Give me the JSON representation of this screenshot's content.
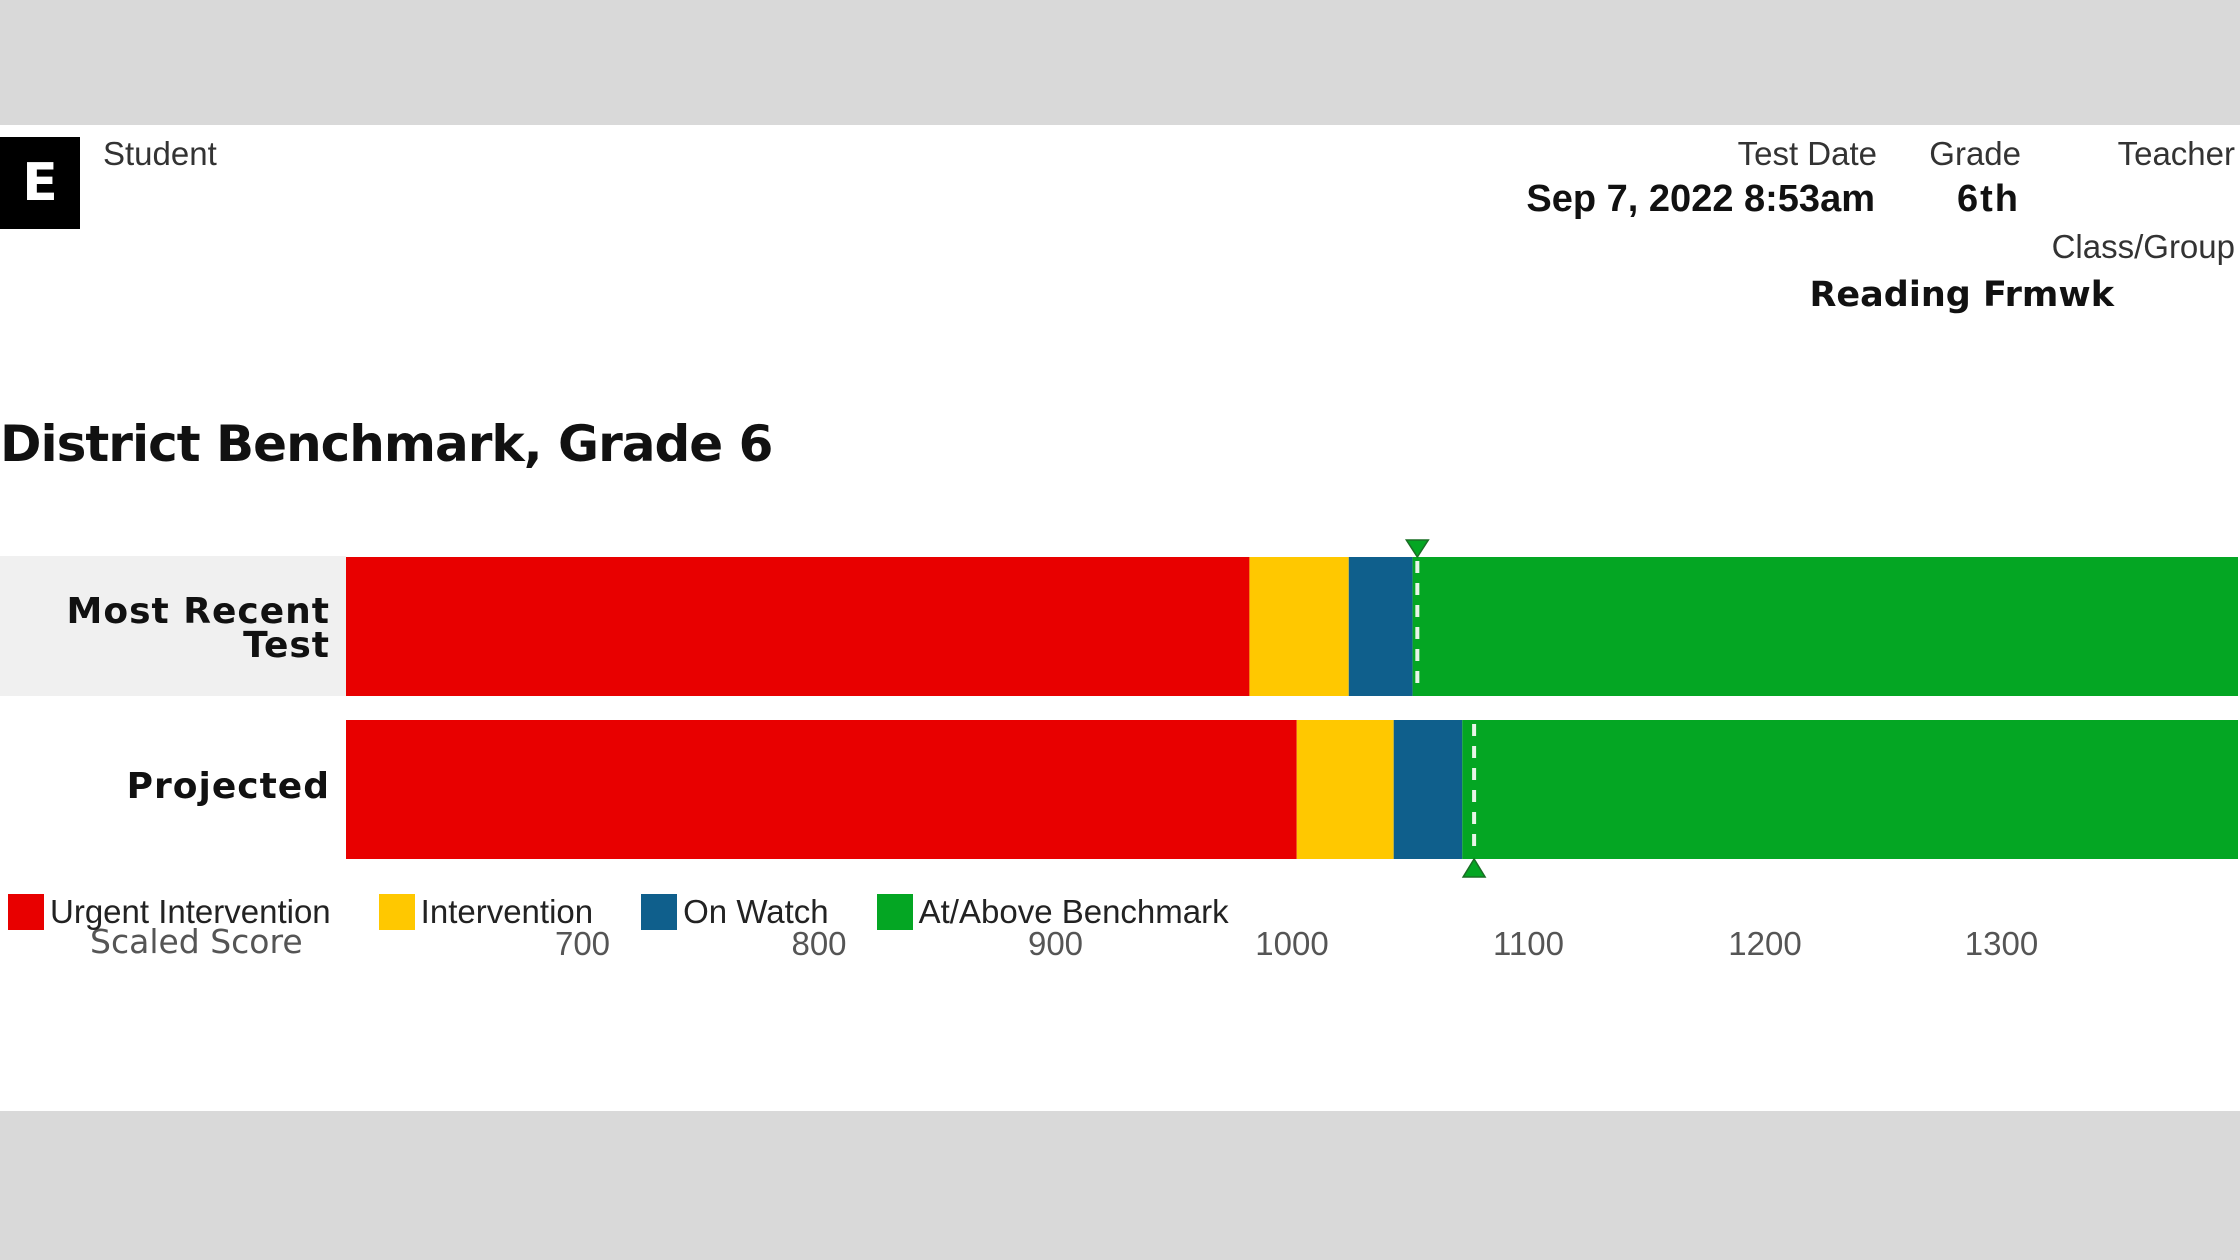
{
  "header": {
    "logo_letter": "E",
    "student_label": "Student",
    "student_value": "",
    "test_date_label": "Test Date",
    "test_date_value": "Sep 7, 2022 8:53am",
    "grade_label": "Grade",
    "grade_value": "6th",
    "teacher_label": "Teacher",
    "teacher_value": "",
    "class_group_label": "Class/Group",
    "class_group_value": "Reading Frmwk"
  },
  "colors": {
    "urgent_intervention": "#e80000",
    "intervention": "#ffc800",
    "on_watch": "#0f5f8c",
    "at_above_benchmark": "#04a623",
    "marker": "#04a623",
    "row_highlight": "#f0f0f0",
    "page_background": "#d9d9d9"
  },
  "chart_data": {
    "type": "bar",
    "orientation": "horizontal-stacked-range",
    "title": "District Benchmark, Grade 6",
    "xlabel": "Scaled Score",
    "ylabel": "",
    "xlim": [
      600,
      1400
    ],
    "x_ticks": [
      700,
      800,
      900,
      1000,
      1100,
      1200,
      1300
    ],
    "grid": false,
    "legend_position": "bottom-left",
    "categories": [
      "Most Recent\nTest",
      "Projected"
    ],
    "series": [
      {
        "name": "Urgent Intervention",
        "key": "urgent_intervention",
        "ranges": [
          [
            600,
            982
          ],
          [
            600,
            1002
          ]
        ]
      },
      {
        "name": "Intervention",
        "key": "intervention",
        "ranges": [
          [
            982,
            1024
          ],
          [
            1002,
            1043
          ]
        ]
      },
      {
        "name": "On Watch",
        "key": "on_watch",
        "ranges": [
          [
            1024,
            1051
          ],
          [
            1043,
            1072
          ]
        ]
      },
      {
        "name": "At/Above Benchmark",
        "key": "at_above_benchmark",
        "ranges": [
          [
            1051,
            1400
          ],
          [
            1072,
            1400
          ]
        ]
      }
    ],
    "markers": [
      {
        "category": "Most Recent\nTest",
        "score": 1053,
        "pointer": "down-triangle-top"
      },
      {
        "category": "Projected",
        "score": 1077,
        "pointer": "up-triangle-bottom"
      }
    ]
  }
}
